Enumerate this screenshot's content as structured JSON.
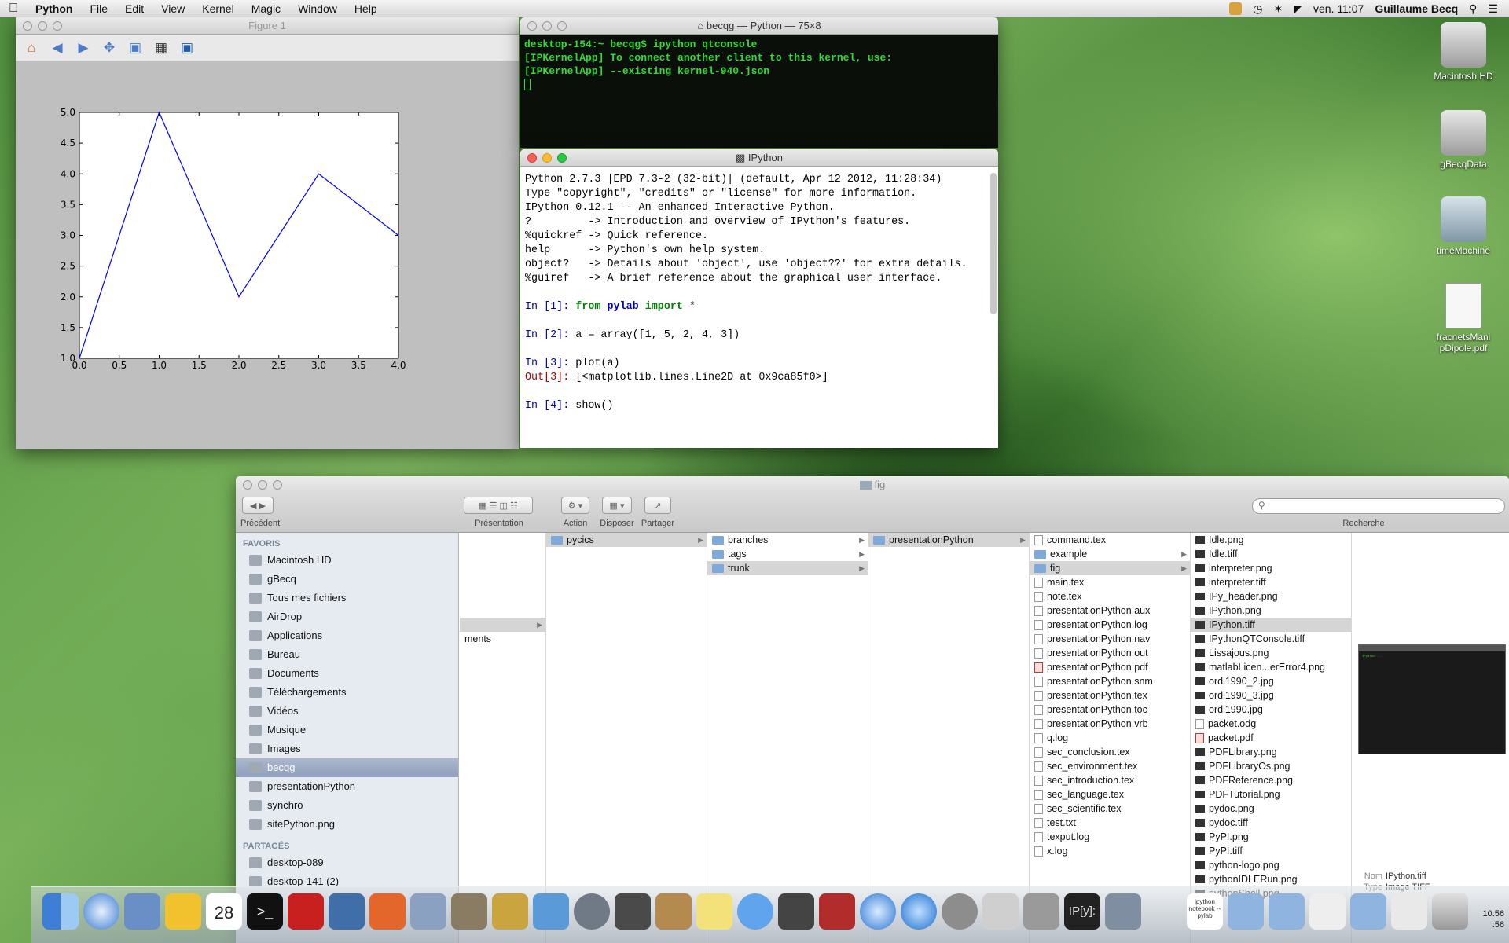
{
  "menubar": {
    "app": "Python",
    "items": [
      "File",
      "Edit",
      "View",
      "Kernel",
      "Magic",
      "Window",
      "Help"
    ],
    "clock": "ven. 11:07",
    "user": "Guillaume Becq"
  },
  "figure": {
    "title": "Figure 1"
  },
  "chart_data": {
    "type": "line",
    "x": [
      0,
      1,
      2,
      3,
      4
    ],
    "values": [
      1,
      5,
      2,
      4,
      3
    ],
    "xlim": [
      0.0,
      4.0
    ],
    "ylim": [
      1.0,
      5.0
    ],
    "xticks": [
      "0.0",
      "0.5",
      "1.0",
      "1.5",
      "2.0",
      "2.5",
      "3.0",
      "3.5",
      "4.0"
    ],
    "yticks": [
      "1.0",
      "1.5",
      "2.0",
      "2.5",
      "3.0",
      "3.5",
      "4.0",
      "4.5",
      "5.0"
    ],
    "color": "#0000ff",
    "grid": false
  },
  "terminal": {
    "title": "becqg — Python — 75×8",
    "lines": [
      "desktop-154:~ becqg$ ipython qtconsole",
      "[IPKernelApp] To connect another client to this kernel, use:",
      "[IPKernelApp] --existing kernel-940.json"
    ]
  },
  "ipython": {
    "title": "IPython",
    "banner": [
      "Python 2.7.3 |EPD 7.3-2 (32-bit)| (default, Apr 12 2012, 11:28:34)",
      "Type \"copyright\", \"credits\" or \"license\" for more information.",
      "",
      "IPython 0.12.1 -- An enhanced Interactive Python.",
      "?         -> Introduction and overview of IPython's features.",
      "%quickref -> Quick reference.",
      "help      -> Python's own help system.",
      "object?   -> Details about 'object', use 'object??' for extra details.",
      "%guiref   -> A brief reference about the graphical user interface."
    ],
    "in1_prompt": "In [1]:",
    "in1_a": "from",
    "in1_b": "pylab",
    "in1_c": "import",
    "in1_d": " *",
    "in2_prompt": "In [2]:",
    "in2": " a = array([1, 5, 2, 4, 3])",
    "in3_prompt": "In [3]:",
    "in3": " plot(a)",
    "out3_prompt": "Out[3]:",
    "out3": " [<matplotlib.lines.Line2D at 0x9ca85f0>]",
    "in4_prompt": "In [4]:",
    "in4": " show()"
  },
  "desktop_icons": [
    "Macintosh HD",
    "gBecqData",
    "timeMachine",
    "fracnetsMani pDipole.pdf"
  ],
  "finder": {
    "title": "fig",
    "back_label": "Précédent",
    "labels": {
      "presentation": "Présentation",
      "action": "Action",
      "disposer": "Disposer",
      "partager": "Partager",
      "search": "Recherche"
    },
    "fav_header": "FAVORIS",
    "favorites": [
      "Macintosh HD",
      "gBecq",
      "Tous mes fichiers",
      "AirDrop",
      "Applications",
      "Bureau",
      "Documents",
      "Téléchargements",
      "Vidéos",
      "Musique",
      "Images",
      "becqg",
      "presentationPython",
      "synchro",
      "sitePython.png"
    ],
    "shared_header": "PARTAGÉS",
    "shared": [
      "desktop-089",
      "desktop-141 (2)"
    ],
    "col0_partial": "ments",
    "col1": [
      "pycics"
    ],
    "col2": [
      "branches",
      "tags",
      "trunk"
    ],
    "col3": [
      "presentationPython"
    ],
    "col4": [
      "command.tex",
      "example",
      "fig",
      "main.tex",
      "note.tex",
      "presentationPython.aux",
      "presentationPython.log",
      "presentationPython.nav",
      "presentationPython.out",
      "presentationPython.pdf",
      "presentationPython.snm",
      "presentationPython.tex",
      "presentationPython.toc",
      "presentationPython.vrb",
      "q.log",
      "sec_conclusion.tex",
      "sec_environment.tex",
      "sec_introduction.tex",
      "sec_language.tex",
      "sec_scientific.tex",
      "test.txt",
      "texput.log",
      "x.log"
    ],
    "col5": [
      "Idle.png",
      "Idle.tiff",
      "interpreter.png",
      "interpreter.tiff",
      "IPy_header.png",
      "IPython.png",
      "IPython.tiff",
      "IPythonQTConsole.tiff",
      "Lissajous.png",
      "matlabLicen...erError4.png",
      "ordi1990_2.jpg",
      "ordi1990_3.jpg",
      "ordi1990.jpg",
      "packet.odg",
      "packet.pdf",
      "PDFLibrary.png",
      "PDFLibraryOs.png",
      "PDFReference.png",
      "PDFTutorial.png",
      "pydoc.png",
      "pydoc.tiff",
      "PyPI.png",
      "PyPI.tiff",
      "python-logo.png",
      "pythonIDLERun.png",
      "pythonShell.png"
    ],
    "info": {
      "name_key": "Nom",
      "name_val": "IPython.tiff",
      "type_key": "Type",
      "type_val": "Image TIFF"
    }
  },
  "dock": {
    "ipython_label": "IP[y]:",
    "notebook_label": "ipython notebook --pylab",
    "calendar_day": "28",
    "clock_time": "10:56",
    "clock_sec": ":56"
  }
}
